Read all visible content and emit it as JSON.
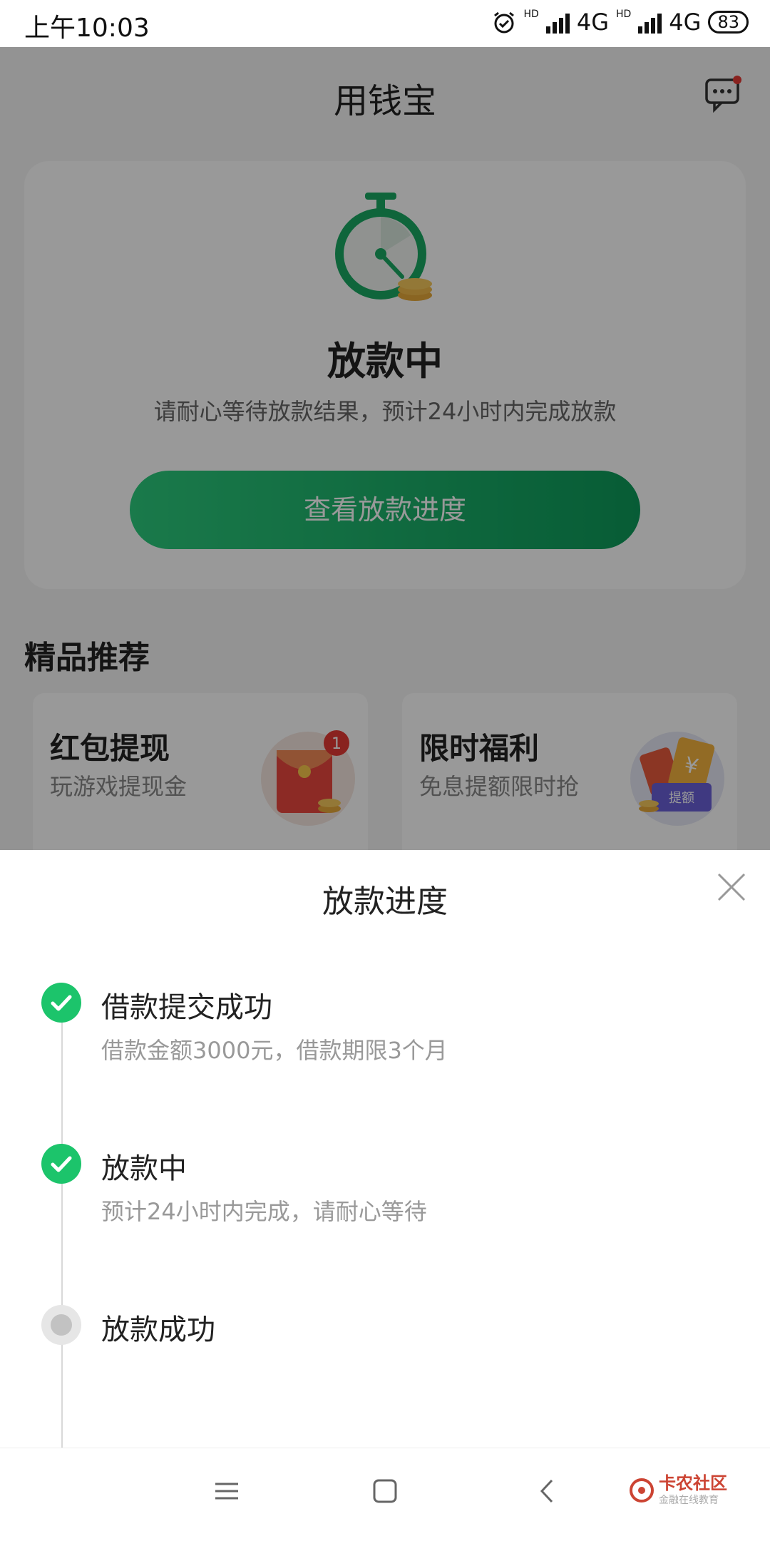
{
  "status_bar": {
    "time": "上午10:03",
    "network_1": "4G",
    "network_2": "4G",
    "hd_1": "HD",
    "hd_2": "HD",
    "battery": "83"
  },
  "header": {
    "title": "用钱宝"
  },
  "loan_card": {
    "status_title": "放款中",
    "subtitle": "请耐心等待放款结果，预计24小时内完成放款",
    "button_label": "查看放款进度"
  },
  "recommend": {
    "section_title": "精品推荐",
    "items": [
      {
        "title": "红包提现",
        "subtitle": "玩游戏提现金",
        "badge": "1"
      },
      {
        "title": "限时福利",
        "subtitle": "免息提额限时抢",
        "badge_text": "提额"
      }
    ]
  },
  "progress_sheet": {
    "title": "放款进度",
    "steps": [
      {
        "title": "借款提交成功",
        "desc": "借款金额3000元，借款期限3个月",
        "state": "done"
      },
      {
        "title": "放款中",
        "desc": "预计24小时内完成，请耐心等待",
        "state": "done"
      },
      {
        "title": "放款成功",
        "desc": "",
        "state": "pending"
      }
    ]
  },
  "watermark": {
    "text": "卡农社区",
    "sub": "金融在线教育"
  },
  "colors": {
    "accent": "#1cc46b",
    "accent_dark": "#0d9a5a"
  }
}
